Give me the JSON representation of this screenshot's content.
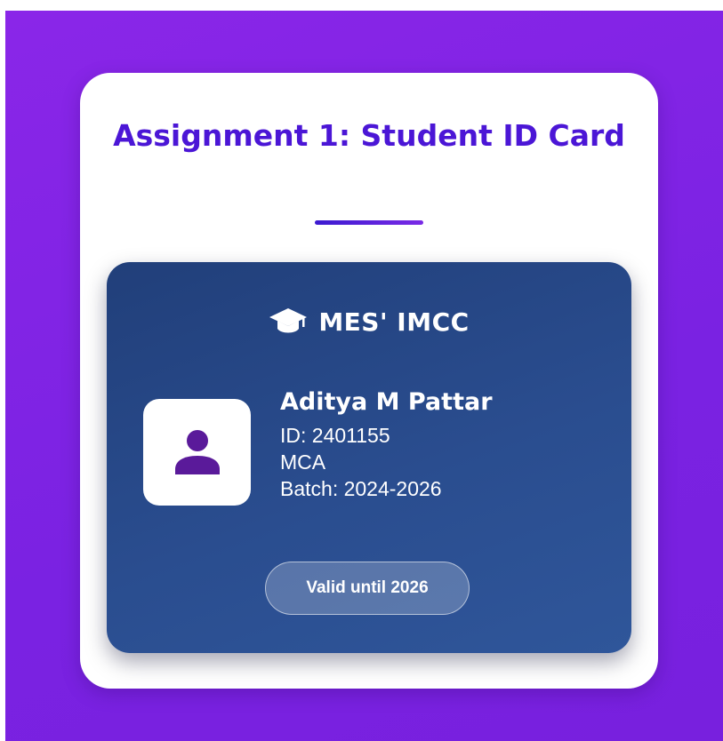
{
  "header": {
    "title": "Assignment 1: Student ID Card"
  },
  "card": {
    "brand": {
      "icon": "graduation-cap-icon",
      "name": "MES' IMCC"
    },
    "photo_icon": "user-icon",
    "student": {
      "name": "Aditya M Pattar",
      "id": "ID: 2401155",
      "course": "MCA",
      "batch": "Batch: 2024-2026"
    },
    "validity": "Valid until 2026"
  },
  "colors": {
    "background": "#7c22e2",
    "title": "#4b16d6",
    "card": "#2a4d8f",
    "avatar": "#5a1a9a"
  }
}
